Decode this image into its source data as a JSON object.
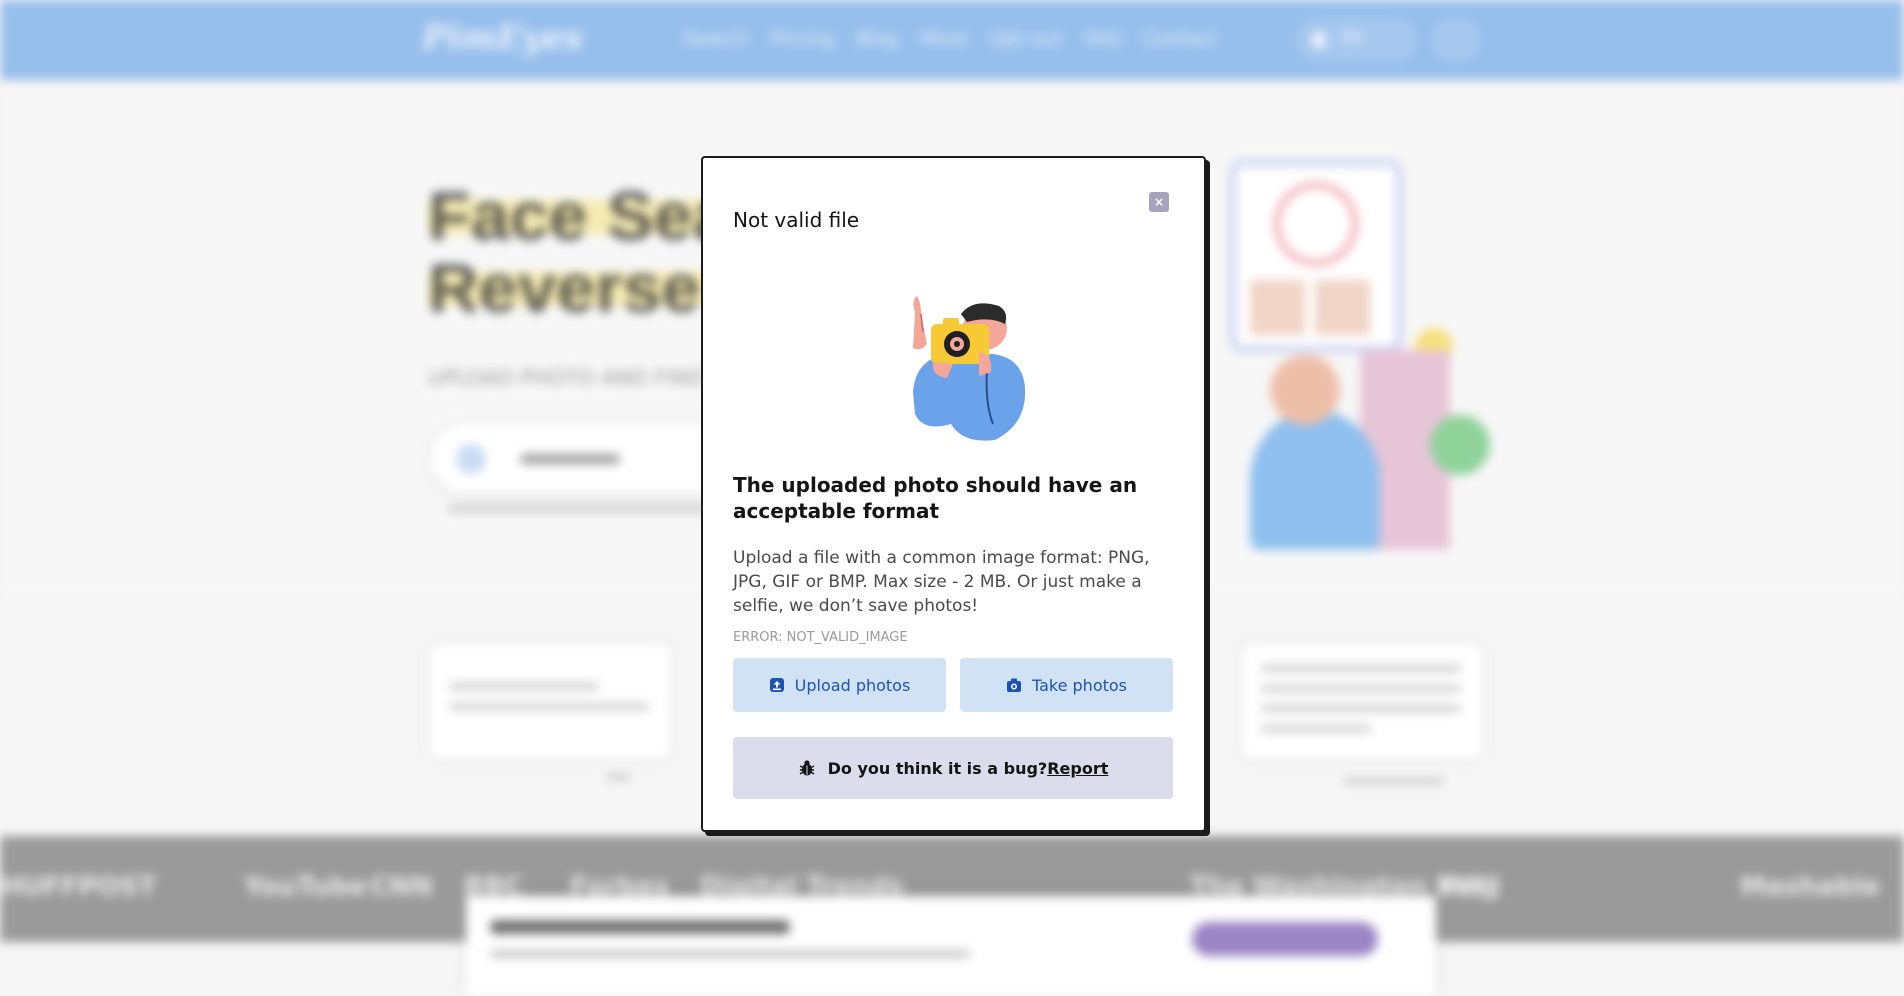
{
  "modal": {
    "title": "Not valid file",
    "close_label": "×",
    "heading": "The uploaded photo should have an acceptable format",
    "description": "Upload a file with a common image format: PNG, JPG, GIF or BMP. Max size - 2 MB. Or just make a selfie, we don’t save photos!",
    "error_code": "ERROR: NOT_VALID_IMAGE",
    "upload_button": "Upload photos",
    "take_button": "Take photos",
    "bug_question": "Do you think it is a bug?",
    "report_link": "Report"
  },
  "background": {
    "logo": "PimEyes",
    "nav": [
      "Search",
      "Pricing",
      "Blog",
      "More",
      "Opt-out",
      "FAQ",
      "Contact"
    ],
    "language": "EN",
    "hero_line1": "Face Search Engine",
    "hero_line2": "Reverse Image Search",
    "hero_sub": "UPLOAD PHOTO AND FIND",
    "press": [
      "HUFFPOST",
      "YouTube",
      "CNN",
      "BBC",
      "Forbes",
      "Digital Trends",
      "The Washington Post",
      "WSJ",
      "Mashable"
    ]
  },
  "icons": {
    "upload": "upload-icon",
    "camera": "camera-icon",
    "bug": "bug-icon",
    "close": "close-icon"
  },
  "colors": {
    "topbar": "#97bfec",
    "action_button_bg": "#d2e2f5",
    "action_button_text": "#1d53b5",
    "bug_bar_bg": "#dcdcec",
    "close_button_bg": "#a4a4bd"
  }
}
